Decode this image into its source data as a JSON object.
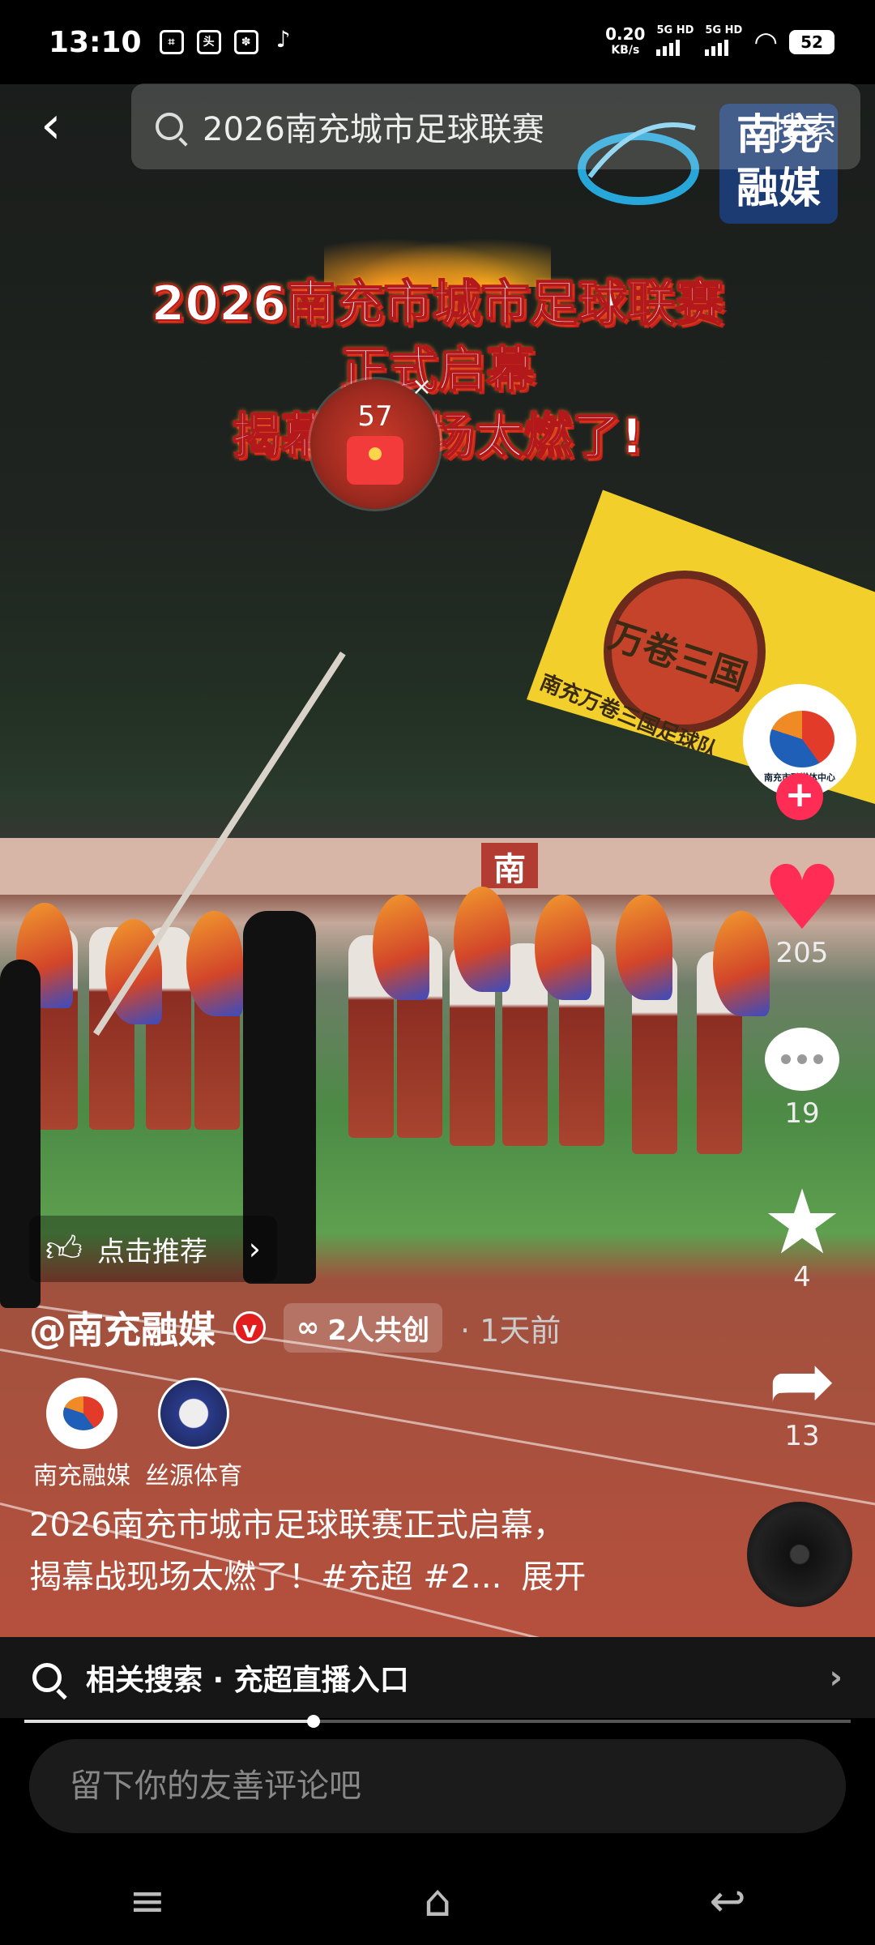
{
  "status": {
    "time": "13:10",
    "net_speed": "0.20",
    "net_unit": "KB/s",
    "sig1": "5G HD",
    "sig2": "5G HD",
    "battery": "52"
  },
  "search": {
    "query": "2026南充城市足球联赛",
    "button": "搜索"
  },
  "overlay_title": {
    "line1": "2026南充市城市足球联赛",
    "line2": "正式启幕",
    "line3": "揭幕战现场太燃了!"
  },
  "brand_watermark": "南充融媒",
  "banner_text": "南",
  "red_packet": {
    "count": "57"
  },
  "flag": {
    "text1": "万卷三国",
    "text2": "南充万卷三国足球队"
  },
  "rail": {
    "avatar_caption": "南充市融媒体中心",
    "likes": "205",
    "comments": "19",
    "favorites": "4",
    "shares": "13"
  },
  "recommend": {
    "label": "点击推荐"
  },
  "post": {
    "author": "@南充融媒",
    "v_badge": "v",
    "cocreate": "2人共创",
    "time_ago": "· 1天前",
    "collaborators": [
      {
        "name": "南充融媒"
      },
      {
        "name": "丝源体育"
      }
    ],
    "description_line1": "2026南充市城市足球联赛正式启幕，",
    "description_line2": "揭幕战现场太燃了！#充超 #2...",
    "expand": "展开"
  },
  "related": {
    "label": "相关搜索 · 充超直播入口"
  },
  "progress": {
    "fraction": 0.35
  },
  "comment": {
    "placeholder": "留下你的友善评论吧"
  },
  "colors": {
    "accent": "#ff2d55",
    "badge": "#e31d1d"
  }
}
